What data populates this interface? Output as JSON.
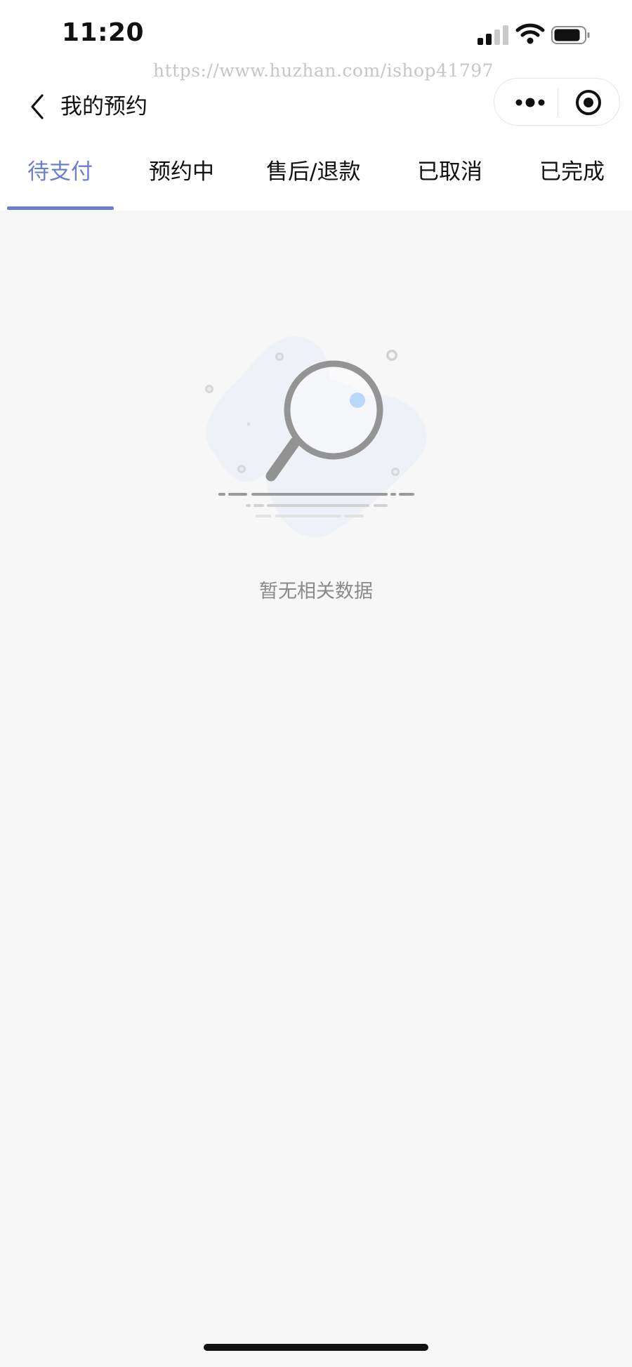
{
  "status_bar": {
    "time": "11:20"
  },
  "watermark": "https://www.huzhan.com/ishop41797",
  "nav": {
    "title": "我的预约"
  },
  "tabs": [
    {
      "label": "待支付",
      "active": true
    },
    {
      "label": "预约中",
      "active": false
    },
    {
      "label": "售后/退款",
      "active": false
    },
    {
      "label": "已取消",
      "active": false
    },
    {
      "label": "已完成",
      "active": false
    }
  ],
  "empty": {
    "text": "暂无相关数据"
  },
  "colors": {
    "accent": "#6b7fcf",
    "background": "#f7f7f7",
    "muted_text": "#8a8a8a"
  },
  "icons": {
    "back": "chevron-left-icon",
    "more": "more-dots-icon",
    "target": "target-icon",
    "signal": "signal-icon",
    "wifi": "wifi-icon",
    "battery": "battery-icon",
    "empty": "magnifier-illustration"
  }
}
